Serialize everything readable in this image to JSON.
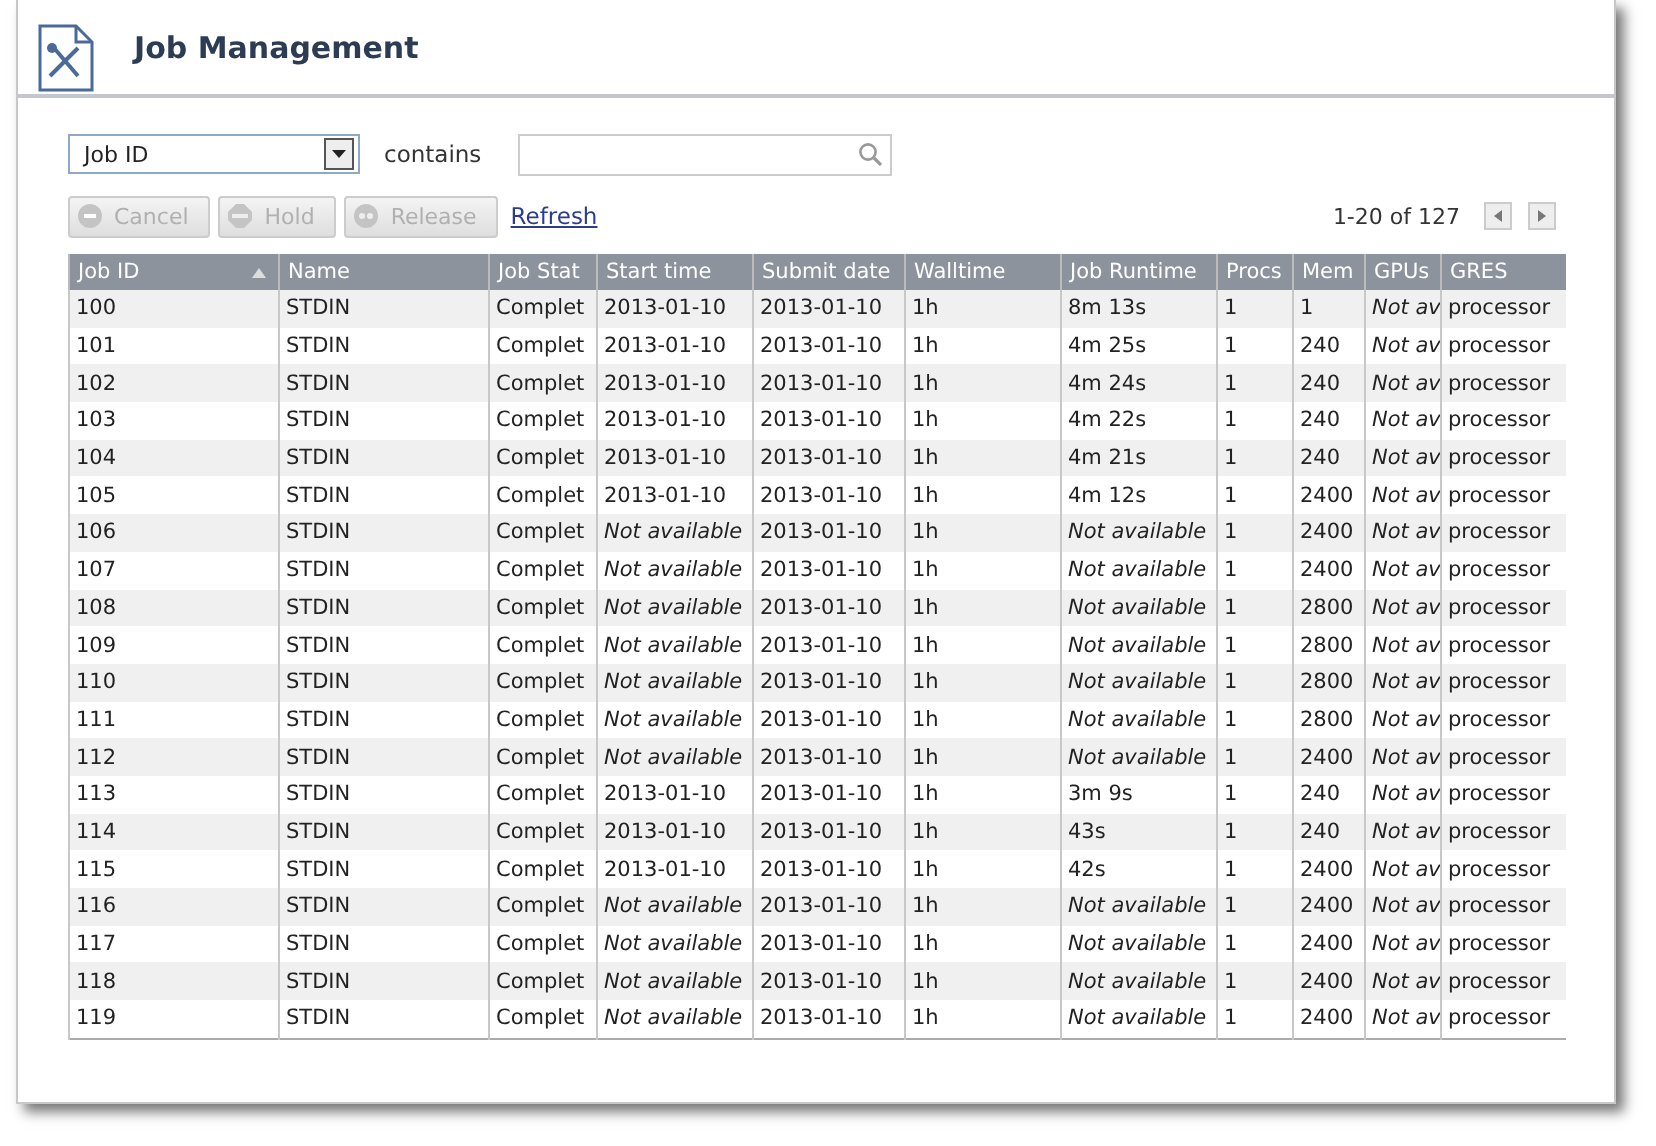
{
  "title": "Job Management",
  "filter": {
    "field": "Job ID",
    "operator": "contains"
  },
  "buttons": [
    {
      "label": "Cancel",
      "kind": "cancel",
      "disabled": true
    },
    {
      "label": "Hold",
      "kind": "hold",
      "disabled": true
    },
    {
      "label": "Release",
      "kind": "release",
      "disabled": true
    }
  ],
  "refresh": "Refresh",
  "pager": {
    "text": "1-20 of 127"
  },
  "table": {
    "columns": [
      {
        "label": "Job ID",
        "sorted": true
      },
      {
        "label": "Name",
        "sorted": false
      },
      {
        "label": "Job Stat",
        "sorted": false
      },
      {
        "label": "Start time",
        "sorted": false
      },
      {
        "label": "Submit date",
        "sorted": false
      },
      {
        "label": "Walltime",
        "sorted": false
      },
      {
        "label": "Job Runtime",
        "sorted": false
      },
      {
        "label": "Procs",
        "sorted": false
      },
      {
        "label": "Mem",
        "sorted": false
      },
      {
        "label": "GPUs",
        "sorted": false
      },
      {
        "label": "GRES",
        "sorted": false
      }
    ],
    "rows": [
      {
        "times_known": true,
        "cells": [
          "100",
          "STDIN",
          "Complet",
          "2013-01-10",
          "2013-01-10",
          "1h",
          "8m 13s",
          "1",
          "1",
          "Not av",
          "processor"
        ]
      },
      {
        "times_known": true,
        "cells": [
          "101",
          "STDIN",
          "Complet",
          "2013-01-10",
          "2013-01-10",
          "1h",
          "4m 25s",
          "1",
          "240",
          "Not av",
          "processor"
        ]
      },
      {
        "times_known": true,
        "cells": [
          "102",
          "STDIN",
          "Complet",
          "2013-01-10",
          "2013-01-10",
          "1h",
          "4m 24s",
          "1",
          "240",
          "Not av",
          "processor"
        ]
      },
      {
        "times_known": true,
        "cells": [
          "103",
          "STDIN",
          "Complet",
          "2013-01-10",
          "2013-01-10",
          "1h",
          "4m 22s",
          "1",
          "240",
          "Not av",
          "processor"
        ]
      },
      {
        "times_known": true,
        "cells": [
          "104",
          "STDIN",
          "Complet",
          "2013-01-10",
          "2013-01-10",
          "1h",
          "4m 21s",
          "1",
          "240",
          "Not av",
          "processor"
        ]
      },
      {
        "times_known": true,
        "cells": [
          "105",
          "STDIN",
          "Complet",
          "2013-01-10",
          "2013-01-10",
          "1h",
          "4m 12s",
          "1",
          "2400",
          "Not av",
          "processor"
        ]
      },
      {
        "times_known": false,
        "cells": [
          "106",
          "STDIN",
          "Complet",
          "Not available",
          "2013-01-10",
          "1h",
          "Not available",
          "1",
          "2400",
          "Not av",
          "processor"
        ]
      },
      {
        "times_known": false,
        "cells": [
          "107",
          "STDIN",
          "Complet",
          "Not available",
          "2013-01-10",
          "1h",
          "Not available",
          "1",
          "2400",
          "Not av",
          "processor"
        ]
      },
      {
        "times_known": false,
        "cells": [
          "108",
          "STDIN",
          "Complet",
          "Not available",
          "2013-01-10",
          "1h",
          "Not available",
          "1",
          "2800",
          "Not av",
          "processor"
        ]
      },
      {
        "times_known": false,
        "cells": [
          "109",
          "STDIN",
          "Complet",
          "Not available",
          "2013-01-10",
          "1h",
          "Not available",
          "1",
          "2800",
          "Not av",
          "processor"
        ]
      },
      {
        "times_known": false,
        "cells": [
          "110",
          "STDIN",
          "Complet",
          "Not available",
          "2013-01-10",
          "1h",
          "Not available",
          "1",
          "2800",
          "Not av",
          "processor"
        ]
      },
      {
        "times_known": false,
        "cells": [
          "111",
          "STDIN",
          "Complet",
          "Not available",
          "2013-01-10",
          "1h",
          "Not available",
          "1",
          "2800",
          "Not av",
          "processor"
        ]
      },
      {
        "times_known": false,
        "cells": [
          "112",
          "STDIN",
          "Complet",
          "Not available",
          "2013-01-10",
          "1h",
          "Not available",
          "1",
          "2400",
          "Not av",
          "processor"
        ]
      },
      {
        "times_known": true,
        "cells": [
          "113",
          "STDIN",
          "Complet",
          "2013-01-10",
          "2013-01-10",
          "1h",
          "3m 9s",
          "1",
          "240",
          "Not av",
          "processor"
        ]
      },
      {
        "times_known": true,
        "cells": [
          "114",
          "STDIN",
          "Complet",
          "2013-01-10",
          "2013-01-10",
          "1h",
          "43s",
          "1",
          "240",
          "Not av",
          "processor"
        ]
      },
      {
        "times_known": true,
        "cells": [
          "115",
          "STDIN",
          "Complet",
          "2013-01-10",
          "2013-01-10",
          "1h",
          "42s",
          "1",
          "2400",
          "Not av",
          "processor"
        ]
      },
      {
        "times_known": false,
        "cells": [
          "116",
          "STDIN",
          "Complet",
          "Not available",
          "2013-01-10",
          "1h",
          "Not available",
          "1",
          "2400",
          "Not av",
          "processor"
        ]
      },
      {
        "times_known": false,
        "cells": [
          "117",
          "STDIN",
          "Complet",
          "Not available",
          "2013-01-10",
          "1h",
          "Not available",
          "1",
          "2400",
          "Not av",
          "processor"
        ]
      },
      {
        "times_known": false,
        "cells": [
          "118",
          "STDIN",
          "Complet",
          "Not available",
          "2013-01-10",
          "1h",
          "Not available",
          "1",
          "2400",
          "Not av",
          "processor"
        ]
      },
      {
        "times_known": false,
        "cells": [
          "119",
          "STDIN",
          "Complet",
          "Not available",
          "2013-01-10",
          "1h",
          "Not available",
          "1",
          "2400",
          "Not av",
          "processor"
        ]
      }
    ]
  }
}
